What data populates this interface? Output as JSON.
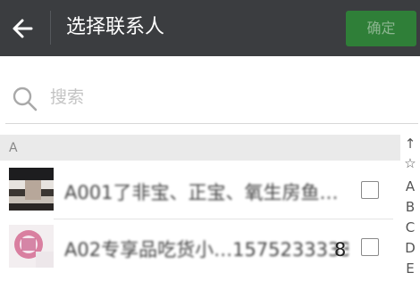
{
  "header": {
    "title": "选择联系人",
    "confirm_label": "确定",
    "back_icon": "arrow-left-icon"
  },
  "search": {
    "placeholder": "搜索",
    "icon": "search-icon"
  },
  "section": {
    "label": "A"
  },
  "contacts": [
    {
      "name": "A001了非宝、正宝、氧生房鱼…",
      "tail": "",
      "checked": false
    },
    {
      "name": "A02专享品吃货小…1575233333",
      "tail": "8",
      "checked": false
    }
  ],
  "index_bar": [
    "↑",
    "☆",
    "A",
    "B",
    "C",
    "D",
    "E"
  ],
  "colors": {
    "header_bg": "#3b3d40",
    "confirm_bg": "#2f7f38",
    "section_bg": "#eaeaea"
  }
}
